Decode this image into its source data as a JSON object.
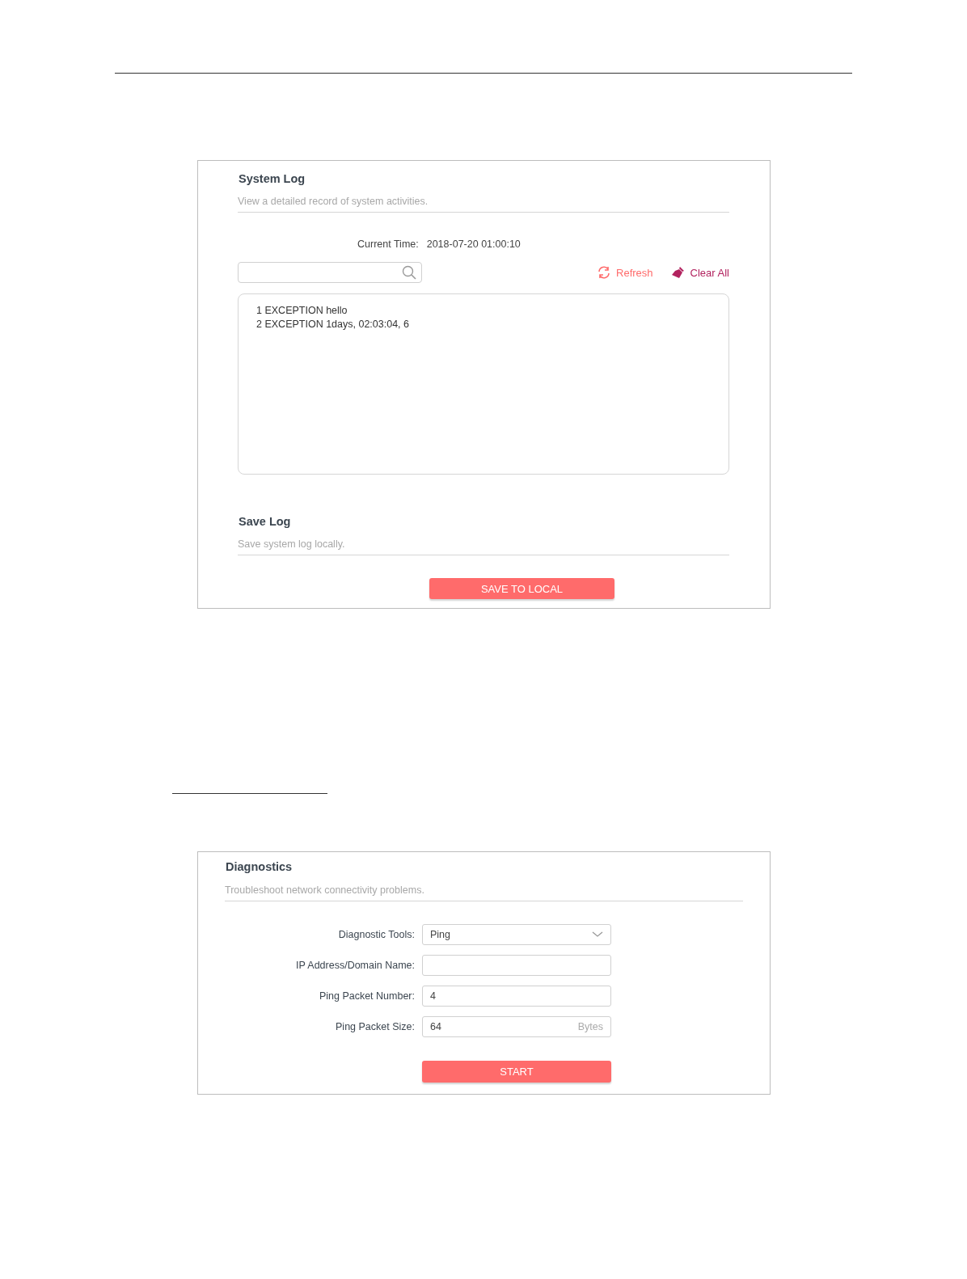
{
  "system_log": {
    "title": "System Log",
    "description": "View a detailed record of system activities.",
    "current_time": {
      "label": "Current Time:",
      "value": "2018-07-20 01:00:10"
    },
    "toolbar": [
      {
        "kind": "refresh",
        "label": "Refresh"
      },
      {
        "kind": "clear",
        "label": "Clear All"
      }
    ],
    "log_lines": [
      "1 EXCEPTION hello",
      "2 EXCEPTION 1days, 02:03:04, 6"
    ]
  },
  "save_log": {
    "title": "Save Log",
    "description": "Save system log locally.",
    "button": "SAVE TO LOCAL"
  },
  "diagnostics": {
    "title": "Diagnostics",
    "description": "Troubleshoot network connectivity problems.",
    "fields": [
      {
        "kind": "select",
        "label": "Diagnostic Tools:",
        "value": "Ping"
      },
      {
        "kind": "text",
        "label": "IP Address/Domain Name:"
      },
      {
        "kind": "text",
        "label": "Ping Packet Number:",
        "value": "4"
      },
      {
        "kind": "text",
        "label": "Ping Packet Size:",
        "value": "64",
        "unit": "Bytes"
      }
    ],
    "button": "START"
  }
}
